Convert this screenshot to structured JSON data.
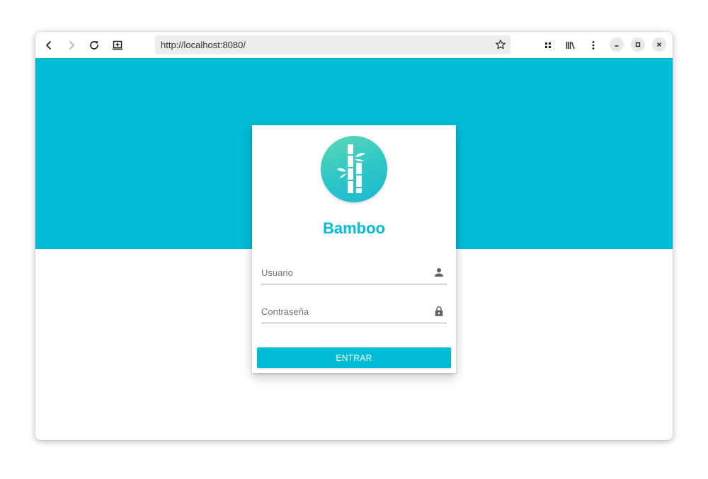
{
  "browser": {
    "url": "http://localhost:8080/",
    "icons": {
      "back": "chevron-left-icon",
      "forward": "chevron-right-icon",
      "reload": "reload-icon",
      "screenshot": "add-page-icon",
      "bookmark": "star-icon",
      "extensions": "grid-icon",
      "library": "library-icon",
      "menu": "kebab-menu-icon",
      "minimize": "minimize-icon",
      "maximize": "maximize-icon",
      "close": "close-icon"
    }
  },
  "theme": {
    "accent": "#00bcd4",
    "logo_gradient_start": "#5ed8b4",
    "logo_gradient_end": "#1cb8d2"
  },
  "login": {
    "brand": "Bamboo",
    "logo_icon": "bamboo-icon",
    "username": {
      "placeholder": "Usuario",
      "value": "",
      "icon": "person-icon"
    },
    "password": {
      "placeholder": "Contraseña",
      "value": "",
      "icon": "lock-icon"
    },
    "submit_label": "ENTRAR"
  }
}
